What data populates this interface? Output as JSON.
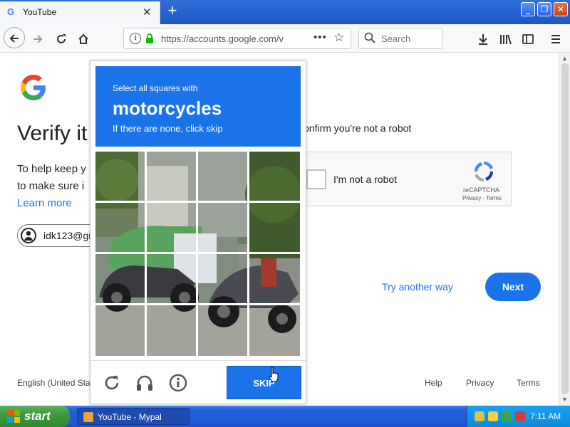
{
  "browser": {
    "tab_title": "YouTube",
    "tab_favicon": "G",
    "tab_close": "✕",
    "new_tab": "+",
    "url": "https://accounts.google.com/v",
    "url_info": "i",
    "search_placeholder": "Search"
  },
  "page": {
    "title": "Verify it",
    "help_line_1": "To help keep y",
    "help_line_2": "to make sure i",
    "learn_more": "Learn more",
    "account_email": "idk123@gr",
    "confirm_text": "onfirm you're not a robot",
    "recaptcha": {
      "label": "I'm not a robot",
      "brand": "reCAPTCHA",
      "terms": "Privacy - Terms"
    },
    "try_another": "Try another way",
    "next_label": "Next",
    "footer": {
      "language": "English (United Sta",
      "help": "Help",
      "privacy": "Privacy",
      "terms": "Terms"
    }
  },
  "captcha": {
    "instruction": "Select all squares with",
    "object": "motorcycles",
    "none_text": "If there are none, click skip",
    "skip_label": "SKIP",
    "grid": {
      "rows": 4,
      "cols": 4
    }
  },
  "taskbar": {
    "start_label": "start",
    "task_label": "YouTube - Mypal",
    "clock": "7:11 AM"
  },
  "colors": {
    "accent": "#1a73e8",
    "titlebar": "#1d56c6",
    "taskbar": "#245edc",
    "start": "#3c9a3c"
  },
  "icons": [
    "back-icon",
    "forward-icon",
    "reload-icon",
    "home-icon",
    "info-icon",
    "lock-icon",
    "more-icon",
    "bookmark-star-icon",
    "search-icon",
    "download-icon",
    "library-icon",
    "sidebar-icon",
    "menu-icon",
    "reload-captcha-icon",
    "audio-icon",
    "info-captcha-icon"
  ]
}
